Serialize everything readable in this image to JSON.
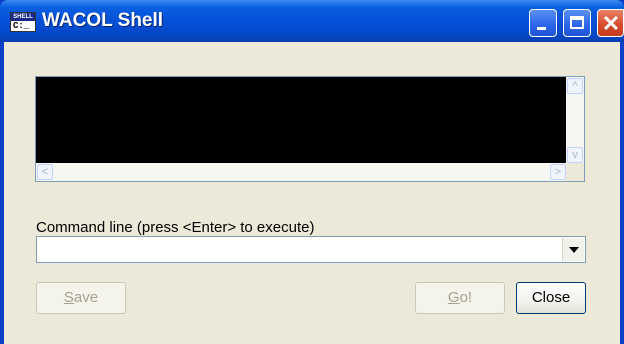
{
  "window": {
    "title": "WACOL Shell",
    "icon_top": "SHELL",
    "icon_bottom": "C:_"
  },
  "titlebar_buttons": {
    "minimize": "minimize-icon",
    "maximize": "maximize-icon",
    "close": "close-icon",
    "close_glyph": "✕"
  },
  "output": {
    "text": "",
    "scroll_up_glyph": "^",
    "scroll_down_glyph": "v",
    "scroll_left_glyph": "<",
    "scroll_right_glyph": ">"
  },
  "command": {
    "label": "Command line (press <Enter> to execute)",
    "value": "",
    "placeholder": ""
  },
  "buttons": {
    "save_mnemonic": "S",
    "save_rest": "ave",
    "go_mnemonic": "G",
    "go_rest": "o!",
    "close": "Close"
  },
  "colors": {
    "titlebar": "#0550d8",
    "client_bg": "#ece9d8",
    "output_bg": "#000000",
    "close_button": "#d6492a"
  }
}
